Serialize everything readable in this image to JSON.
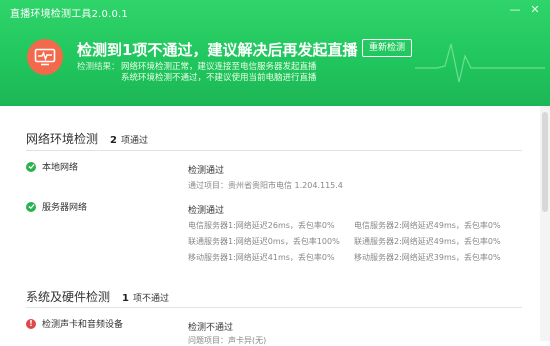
{
  "app": {
    "title": "直播环境检测工具2.0.0.1",
    "window_controls": [
      "—",
      "✕"
    ]
  },
  "header": {
    "headline": "检测到1项不通过，建议解决后再发起直播",
    "retest_button": "重新检测",
    "result_label": "检测结果：",
    "result_line1": "网络环境检测正常，建议连接至电信服务器发起直播",
    "result_line2": "系统环境检测不通过，不建议使用当前电脑进行直播",
    "colors": {
      "header_green": "#20c55d",
      "badge": "#f26a4b"
    }
  },
  "network": {
    "title": "网络环境检测",
    "count": "2",
    "count_text": "项通过",
    "local": {
      "name": "本地网络",
      "status": "检测通过",
      "detail": "通过项目：贵州省贵阳市电信 1.204.115.4"
    },
    "server": {
      "name": "服务器网络",
      "status": "检测通过",
      "rows": [
        [
          "电信服务器1:网络延迟26ms，丢包率0%",
          "电信服务器2:网络延迟49ms，丢包率0%"
        ],
        [
          "联通服务器1:网络延迟0ms，丢包率100%",
          "联通服务器2:网络延迟49ms，丢包率0%"
        ],
        [
          "移动服务器1:网络延迟41ms，丢包率0%",
          "移动服务器2:网络延迟39ms，丢包率0%"
        ]
      ]
    }
  },
  "system": {
    "title": "系统及硬件检测",
    "count": "1",
    "count_text": "项不通过",
    "sound": {
      "name": "检测声卡和音频设备",
      "status": "检测不通过",
      "detail": "问题项目：声卡异(无)"
    }
  }
}
